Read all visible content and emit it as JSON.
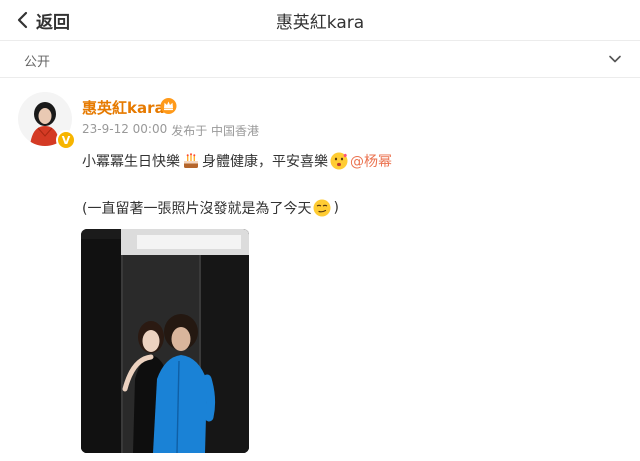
{
  "header": {
    "back_label": "返回",
    "title": "惠英紅kara"
  },
  "privacy": {
    "label": "公开"
  },
  "post": {
    "username": "惠英紅kara",
    "date": "23-9-12 00:00",
    "source": "发布于 中国香港",
    "line1_part1": "小冪冪生日快樂",
    "line1_part2": "身體健康，平安喜樂",
    "mention": "@杨幂",
    "line2_part1": "(一直留著一張照片沒發就是為了今天",
    "line2_part2": ")",
    "icons": [
      "crown-icon",
      "cake-emoji",
      "kiss-emoji",
      "smirk-emoji",
      "verified-badge-icon"
    ]
  },
  "colors": {
    "username": "#e67a00",
    "mention": "#eb7350",
    "verified": "#f7b500",
    "meta": "#999999"
  }
}
